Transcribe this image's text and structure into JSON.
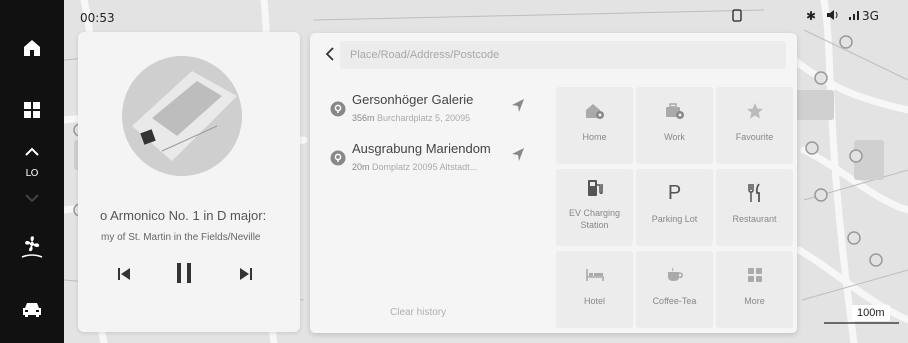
{
  "statusbar": {
    "time": "00:53",
    "network": "3G"
  },
  "rail": {
    "items": [
      "home-icon",
      "apps-icon",
      "climate-up-icon",
      "fan-icon",
      "car-icon"
    ],
    "temp_label": "LO"
  },
  "media": {
    "track_title": "o Armonico No. 1 in D major:",
    "track_artist": "my of St. Martin in the Fields/Neville"
  },
  "search": {
    "placeholder": "Place/Road/Address/Postcode"
  },
  "history": [
    {
      "name": "Gersonhöger Galerie",
      "distance": "356m",
      "address": "Burchardplatz 5, 20095"
    },
    {
      "name": "Ausgrabung Mariendom",
      "distance": "20m",
      "address": "Domplatz 20095 Altstadt..."
    }
  ],
  "clear_history_label": "Clear history",
  "categories": [
    {
      "label": "Home",
      "icon": "home-pin-icon"
    },
    {
      "label": "Work",
      "icon": "work-pin-icon"
    },
    {
      "label": "Favourite",
      "icon": "star-icon"
    },
    {
      "label": "EV Charging Station",
      "icon": "ev-charging-icon"
    },
    {
      "label": "Parking Lot",
      "icon": "parking-icon"
    },
    {
      "label": "Restaurant",
      "icon": "restaurant-icon"
    },
    {
      "label": "Hotel",
      "icon": "hotel-icon"
    },
    {
      "label": "Coffee-Tea",
      "icon": "coffee-icon"
    },
    {
      "label": "More",
      "icon": "more-grid-icon"
    }
  ],
  "map": {
    "scale_label": "100m"
  },
  "colors": {
    "rail_bg": "#111111",
    "panel_bg": "#f5f5f5",
    "tile_bg": "#ececec",
    "icon_gray": "#9a9a9a"
  }
}
